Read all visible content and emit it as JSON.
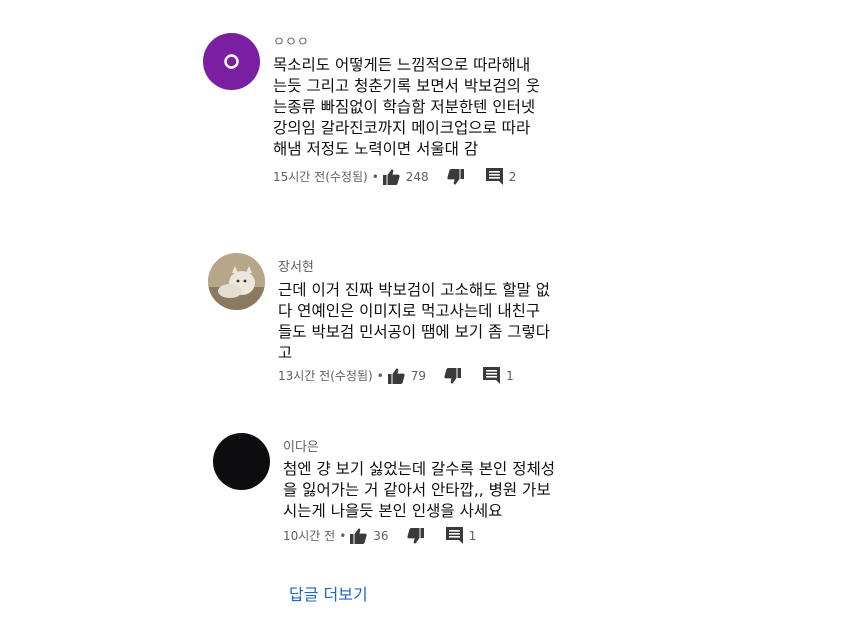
{
  "comments": [
    {
      "author": "ㅇㅇㅇ",
      "lines": [
        "목소리도 어떻게든 느낌적으로 따라해내",
        "는듯 그리고 청춘기록 보면서 박보검의 웃",
        "는종류 빠짐없이 학습함 저분한텐 인터넷",
        "강의임 갈라진코까지 메이크업으로 따라",
        "해냄 저정도 노력이면 서울대 감"
      ],
      "time": "15시간 전(수정됨)",
      "likes": "248",
      "replies": "2",
      "avatar_color": "#7b1fa2"
    },
    {
      "author": "장서현",
      "lines": [
        "근데 이거 진짜 박보검이 고소해도 할말 없",
        "다 연예인은 이미지로 먹고사는데 내친구",
        "들도 박보검 민서공이 땜에 보기 좀 그렇다",
        "고"
      ],
      "time": "13시간 전(수정됨)",
      "likes": "79",
      "replies": "1"
    },
    {
      "author": "이다은",
      "lines": [
        "첨엔 걍 보기 싫었는데 갈수록 본인 정체성",
        "을 잃어가는 거 같아서 안타깝,, 병원 가보",
        "시는게 나을듯 본인 인생을 사세요"
      ],
      "time": "10시간 전",
      "likes": "36",
      "replies": "1",
      "avatar_color": "#0d0d0f"
    }
  ],
  "more_replies_label": "답글 더보기",
  "meta_separator": "•",
  "icons": [
    "thumbs-up-icon",
    "thumbs-down-icon",
    "reply-icon"
  ]
}
